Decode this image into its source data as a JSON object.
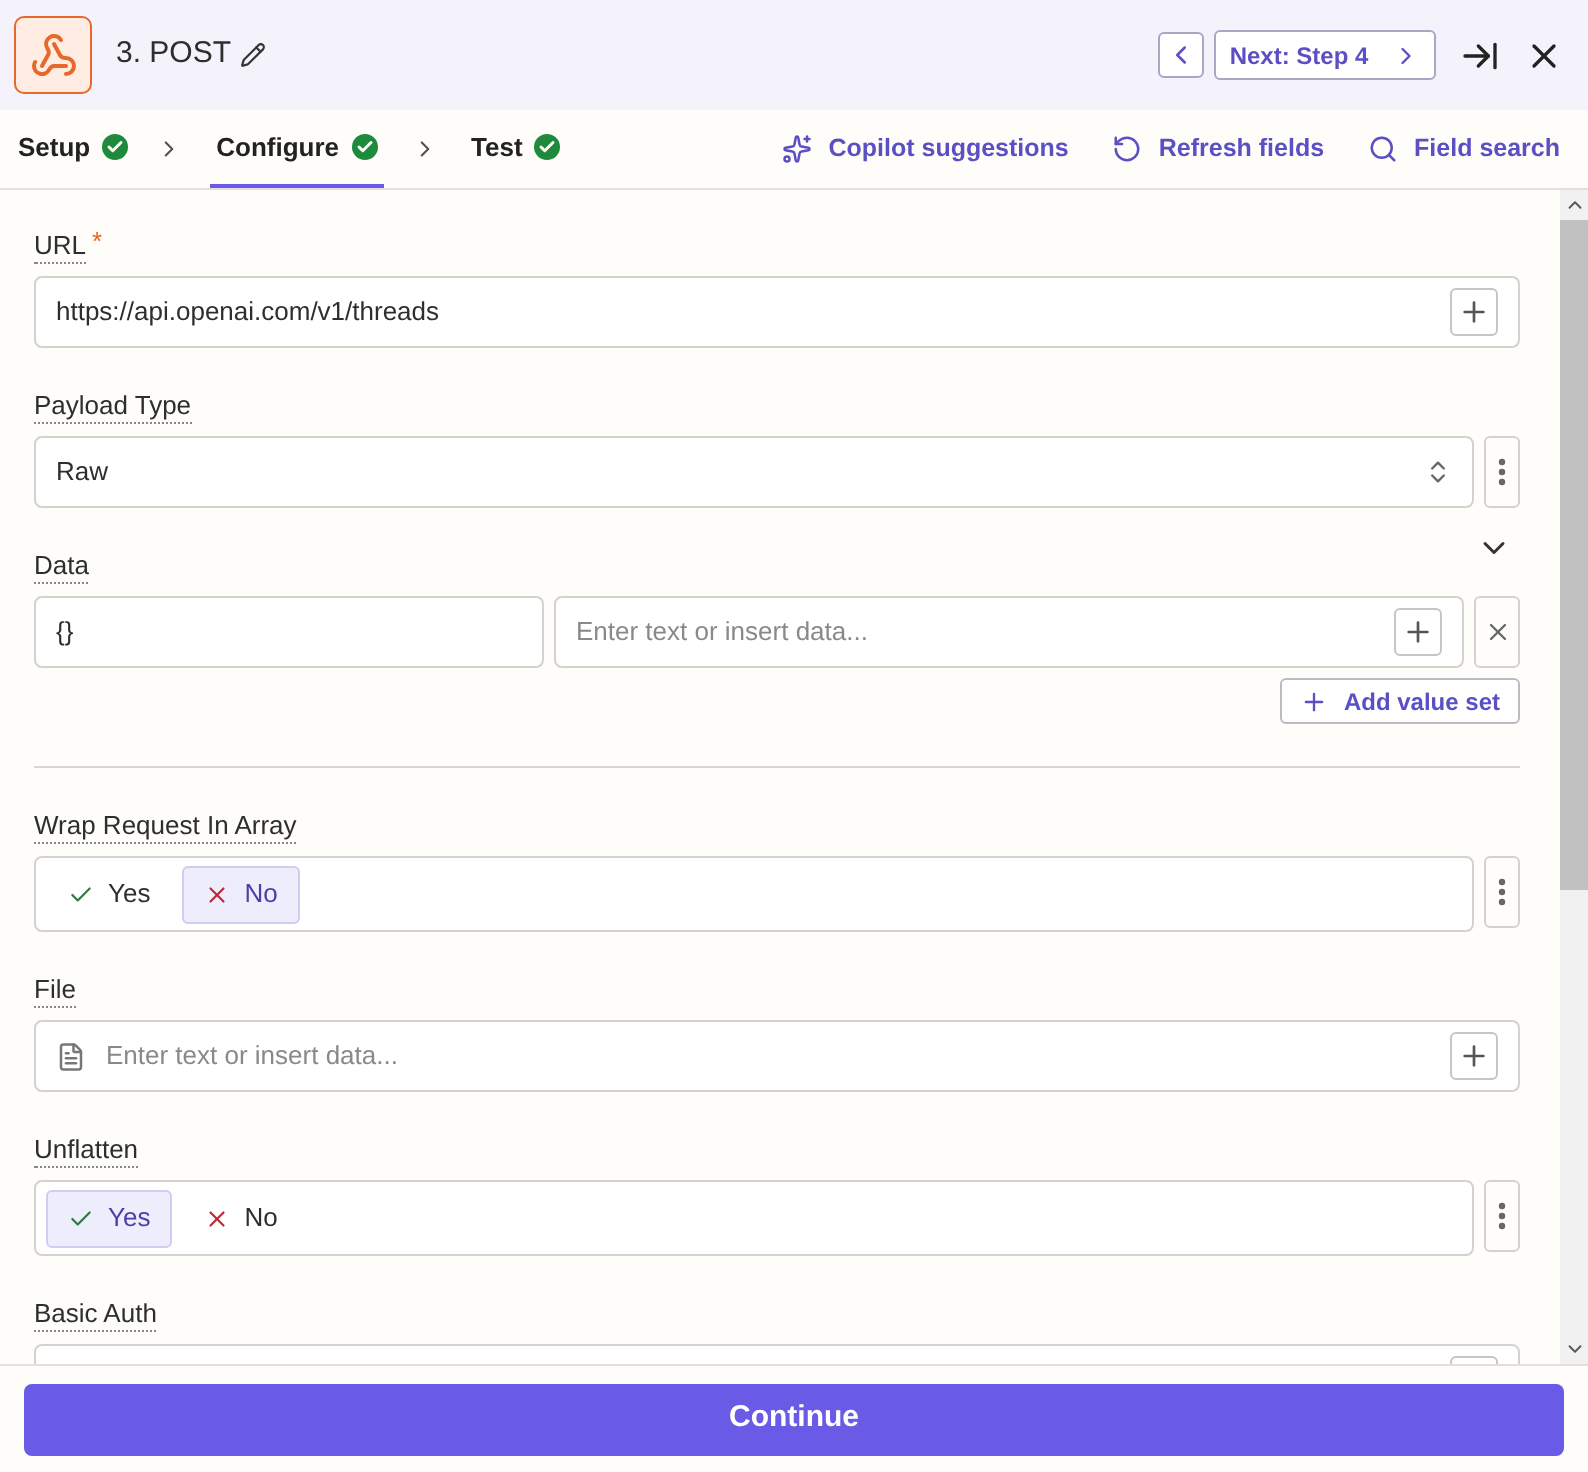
{
  "header": {
    "title": "3. POST",
    "next_button": "Next: Step 4"
  },
  "steps": [
    {
      "label": "Setup",
      "complete": true,
      "selected": false
    },
    {
      "label": "Configure",
      "complete": true,
      "selected": true
    },
    {
      "label": "Test",
      "complete": true,
      "selected": false
    }
  ],
  "tools": [
    {
      "kind": "copilot",
      "label": "Copilot suggestions"
    },
    {
      "kind": "refresh",
      "label": "Refresh fields"
    },
    {
      "kind": "search",
      "label": "Field search"
    }
  ],
  "fields": [
    {
      "kind": "text",
      "label": "URL",
      "required_mark": "*",
      "value": "https://api.openai.com/v1/threads"
    },
    {
      "kind": "select",
      "label": "Payload Type",
      "value": "Raw"
    },
    {
      "kind": "keyvalue",
      "label": "Data",
      "key": "{}",
      "placeholder": "Enter text or insert data...",
      "add_button": "Add value set"
    },
    {
      "kind": "divider"
    },
    {
      "kind": "toggle",
      "label": "Wrap Request In Array",
      "options": [
        {
          "kind": "yes",
          "label": "Yes",
          "selected": false
        },
        {
          "kind": "no",
          "label": "No",
          "selected": true
        }
      ]
    },
    {
      "kind": "file",
      "label": "File",
      "placeholder": "Enter text or insert data..."
    },
    {
      "kind": "toggle",
      "label": "Unflatten",
      "options": [
        {
          "kind": "yes",
          "label": "Yes",
          "selected": true
        },
        {
          "kind": "no",
          "label": "No",
          "selected": false
        }
      ]
    },
    {
      "kind": "text",
      "label": "Basic Auth"
    }
  ],
  "continue_button": "Continue"
}
